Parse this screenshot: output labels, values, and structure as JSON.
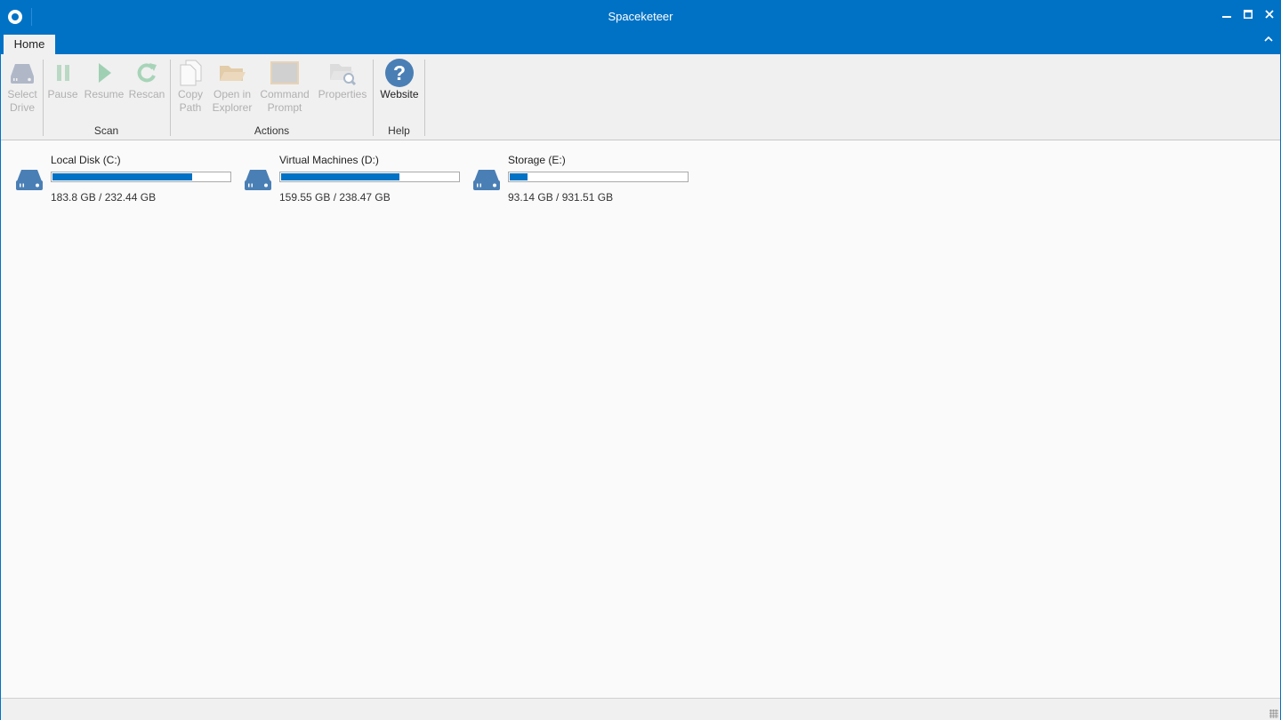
{
  "window": {
    "title": "Spaceketeer"
  },
  "tabs": [
    {
      "label": "Home",
      "active": true
    }
  ],
  "ribbon": {
    "groups": [
      {
        "label": "",
        "buttons": [
          {
            "label1": "Select",
            "label2": "Drive",
            "icon": "drive-icon",
            "enabled": false
          }
        ]
      },
      {
        "label": "Scan",
        "buttons": [
          {
            "label1": "Pause",
            "label2": "",
            "icon": "pause-icon",
            "enabled": false
          },
          {
            "label1": "Resume",
            "label2": "",
            "icon": "play-icon",
            "enabled": false
          },
          {
            "label1": "Rescan",
            "label2": "",
            "icon": "refresh-icon",
            "enabled": false
          }
        ]
      },
      {
        "label": "Actions",
        "buttons": [
          {
            "label1": "Copy",
            "label2": "Path",
            "icon": "copy-icon",
            "enabled": false
          },
          {
            "label1": "Open in",
            "label2": "Explorer",
            "icon": "folder-icon",
            "enabled": false
          },
          {
            "label1": "Command",
            "label2": "Prompt",
            "icon": "terminal-icon",
            "enabled": false
          },
          {
            "label1": "Properties",
            "label2": "",
            "icon": "properties-icon",
            "enabled": false
          }
        ]
      },
      {
        "label": "Help",
        "buttons": [
          {
            "label1": "Website",
            "label2": "",
            "icon": "help-icon",
            "enabled": true
          }
        ]
      }
    ]
  },
  "drives": [
    {
      "name": "Local Disk (C:)",
      "size_text": "183.8 GB / 232.44 GB",
      "fraction": 0.791
    },
    {
      "name": "Virtual Machines (D:)",
      "size_text": "159.55 GB / 238.47 GB",
      "fraction": 0.669
    },
    {
      "name": "Storage (E:)",
      "size_text": "93.14 GB / 931.51 GB",
      "fraction": 0.1
    }
  ],
  "colors": {
    "accent": "#0072c6",
    "disabled_icon": "#b0b8c8",
    "drive_icon": "#4a7fb5"
  }
}
